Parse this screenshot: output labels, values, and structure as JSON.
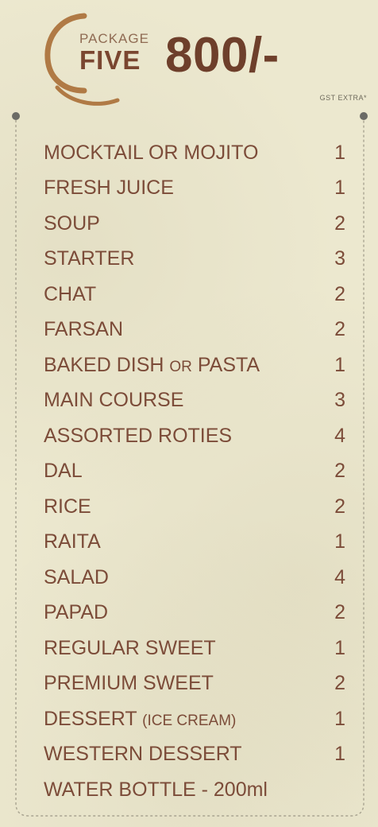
{
  "header": {
    "package_label": "PACKAGE",
    "package_name": "FIVE",
    "price": "800/-",
    "tax_note": "GST EXTRA*"
  },
  "items": [
    {
      "name": "MOCKTAIL OR MOJITO",
      "qty": "1"
    },
    {
      "name": "FRESH JUICE",
      "qty": "1"
    },
    {
      "name": "SOUP",
      "qty": "2"
    },
    {
      "name": "STARTER",
      "qty": "3"
    },
    {
      "name": "CHAT",
      "qty": "2"
    },
    {
      "name": "FARSAN",
      "qty": "2"
    },
    {
      "name": "BAKED DISH",
      "note": "OR",
      "name2": "PASTA",
      "qty": "1"
    },
    {
      "name": "MAIN COURSE",
      "qty": "3"
    },
    {
      "name": "ASSORTED ROTIES",
      "qty": "4"
    },
    {
      "name": "DAL",
      "qty": "2"
    },
    {
      "name": "RICE",
      "qty": "2"
    },
    {
      "name": "RAITA",
      "qty": "1"
    },
    {
      "name": "SALAD",
      "qty": "4"
    },
    {
      "name": "PAPAD",
      "qty": "2"
    },
    {
      "name": "REGULAR SWEET",
      "qty": "1"
    },
    {
      "name": "PREMIUM SWEET",
      "qty": "2"
    },
    {
      "name": "DESSERT",
      "note": "(ICE CREAM)",
      "qty": "1"
    },
    {
      "name": "WESTERN DESSERT",
      "qty": "1"
    },
    {
      "name": "WATER BOTTLE - 200ml",
      "qty": ""
    }
  ],
  "colors": {
    "brand": "#7a4630",
    "logo": "#b07a45",
    "background": "#ece8cf"
  }
}
